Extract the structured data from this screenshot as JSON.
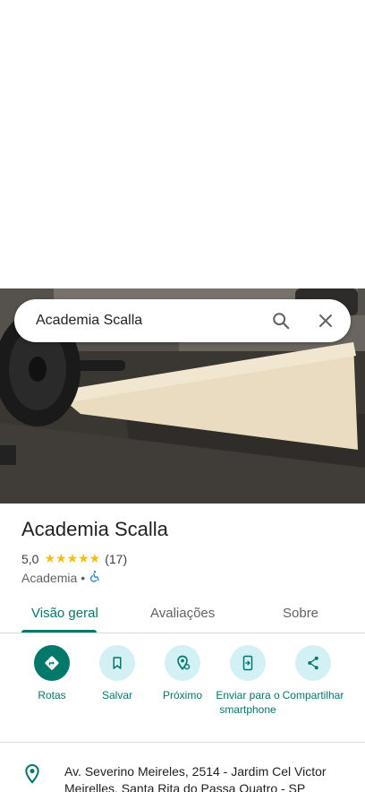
{
  "search": {
    "query": "Academia Scalla"
  },
  "place": {
    "name": "Academia Scalla",
    "rating": "5,0",
    "stars": "★★★★★",
    "review_count": "(17)",
    "category": "Academia",
    "separator": "•"
  },
  "tabs": [
    {
      "label": "Visão geral",
      "active": true
    },
    {
      "label": "Avaliações",
      "active": false
    },
    {
      "label": "Sobre",
      "active": false
    }
  ],
  "actions": [
    {
      "label": "Rotas",
      "icon": "directions-icon"
    },
    {
      "label": "Salvar",
      "icon": "bookmark-icon"
    },
    {
      "label": "Próximo",
      "icon": "nearby-icon"
    },
    {
      "label": "Enviar para o smartphone",
      "icon": "send-to-phone-icon"
    },
    {
      "label": "Compartilhar",
      "icon": "share-icon"
    }
  ],
  "address": "Av. Severino Meireles, 2514 - Jardim Cel Victor Meirelles, Santa Rita do Passa Quatro - SP",
  "colors": {
    "accent": "#00796b",
    "star": "#fbbc04",
    "action_bg": "#d3f0f4"
  }
}
